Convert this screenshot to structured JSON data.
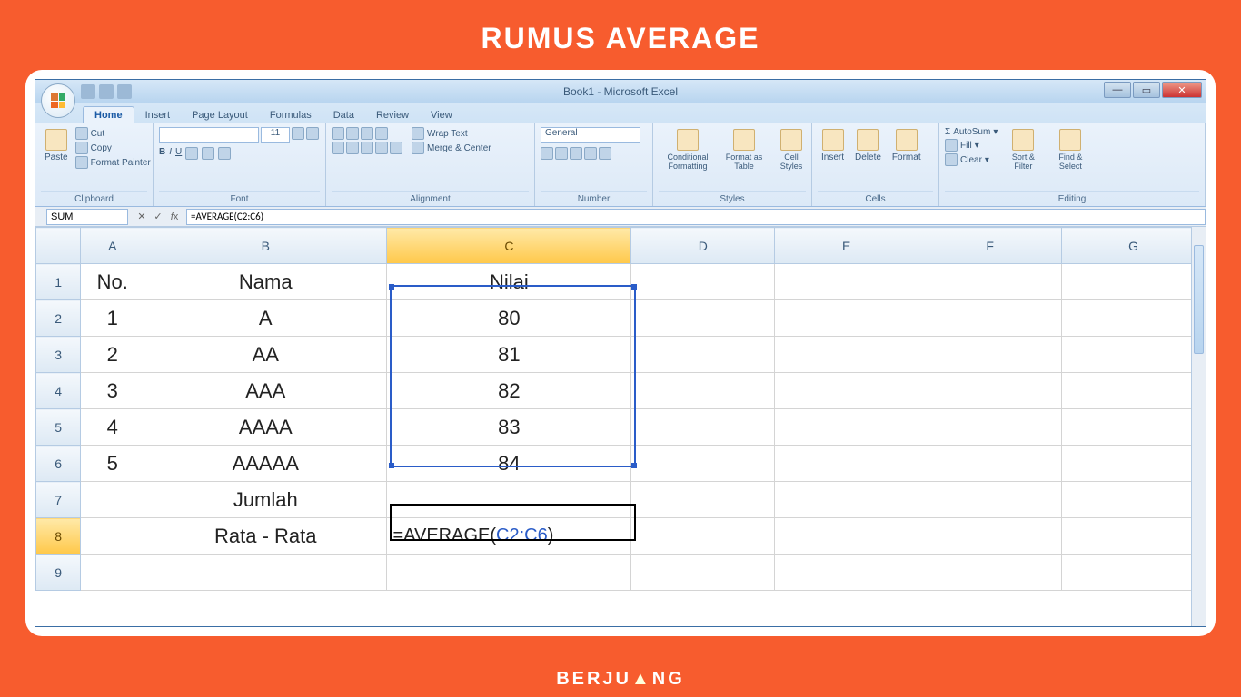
{
  "page": {
    "heading": "RUMUS AVERAGE",
    "brand": "BERJUANG"
  },
  "window": {
    "title": "Book1 - Microsoft Excel"
  },
  "qat": {
    "icons": [
      "save-icon",
      "undo-icon",
      "redo-icon"
    ]
  },
  "win_controls": {
    "min": "—",
    "max": "▭",
    "close": "✕",
    "help": "?"
  },
  "tabs": {
    "items": [
      "Home",
      "Insert",
      "Page Layout",
      "Formulas",
      "Data",
      "Review",
      "View"
    ],
    "active_index": 0
  },
  "ribbon": {
    "clipboard": {
      "label": "Clipboard",
      "paste": "Paste",
      "cut": "Cut",
      "copy": "Copy",
      "painter": "Format Painter"
    },
    "font": {
      "label": "Font",
      "font_name": "",
      "font_size": "11",
      "controls": [
        "B",
        "I",
        "U"
      ]
    },
    "alignment": {
      "label": "Alignment",
      "wrap": "Wrap Text",
      "merge": "Merge & Center"
    },
    "number": {
      "label": "Number",
      "format": "General"
    },
    "styles": {
      "label": "Styles",
      "conditional": "Conditional Formatting",
      "format_table": "Format as Table",
      "cell_styles": "Cell Styles"
    },
    "cells": {
      "label": "Cells",
      "insert": "Insert",
      "delete": "Delete",
      "format": "Format"
    },
    "editing": {
      "label": "Editing",
      "autosum": "AutoSum",
      "fill": "Fill",
      "clear": "Clear",
      "sort": "Sort & Filter",
      "find": "Find & Select"
    }
  },
  "formula_bar": {
    "name_box": "SUM",
    "formula": "=AVERAGE(C2:C6)"
  },
  "columns": [
    "A",
    "B",
    "C",
    "D",
    "E",
    "F",
    "G"
  ],
  "row_numbers": [
    "1",
    "2",
    "3",
    "4",
    "5",
    "6",
    "7",
    "8",
    "9"
  ],
  "cells": {
    "header": {
      "a": "No.",
      "b": "Nama",
      "c": "Nilai"
    },
    "data": [
      {
        "no": "1",
        "nama": "A",
        "nilai": "80"
      },
      {
        "no": "2",
        "nama": "AA",
        "nilai": "81"
      },
      {
        "no": "3",
        "nama": "AAA",
        "nilai": "82"
      },
      {
        "no": "4",
        "nama": "AAAA",
        "nilai": "83"
      },
      {
        "no": "5",
        "nama": "AAAAA",
        "nilai": "84"
      }
    ],
    "row7_b": "Jumlah",
    "row8_b": "Rata - Rata",
    "row8_c_prefix": "=AVERAGE(",
    "row8_c_ref": "C2:C6",
    "row8_c_suffix": ")"
  },
  "chart_data": {
    "type": "table",
    "title": "Nilai",
    "columns": [
      "No.",
      "Nama",
      "Nilai"
    ],
    "rows": [
      [
        1,
        "A",
        80
      ],
      [
        2,
        "AA",
        81
      ],
      [
        3,
        "AAA",
        82
      ],
      [
        4,
        "AAAA",
        83
      ],
      [
        5,
        "AAAAA",
        84
      ]
    ],
    "aggregates": {
      "Jumlah": null,
      "Rata - Rata": "=AVERAGE(C2:C6)"
    }
  }
}
